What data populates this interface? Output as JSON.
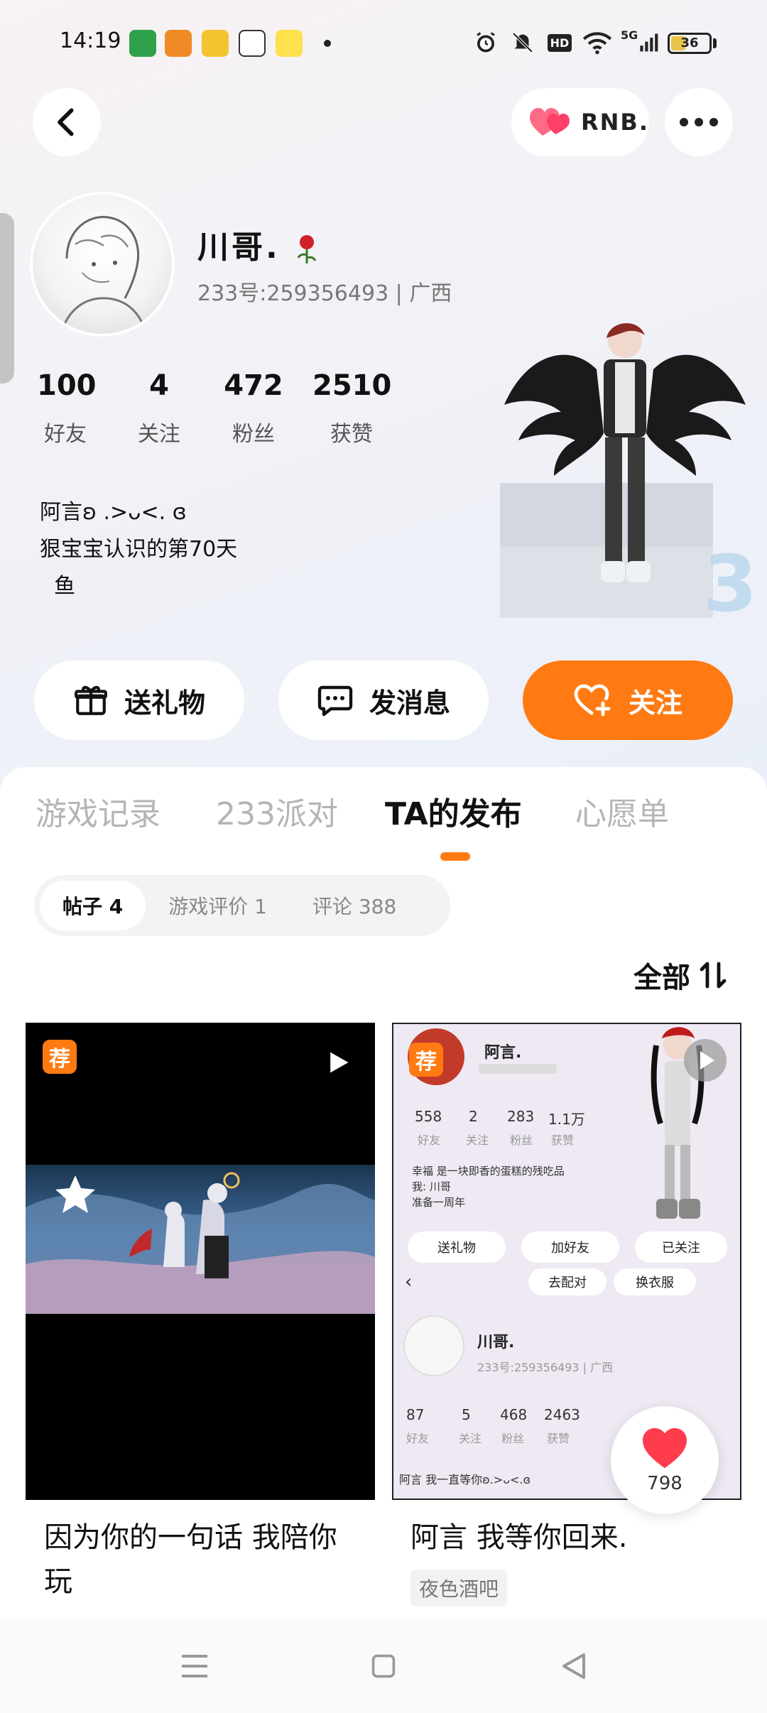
{
  "status_bar": {
    "time": "14:19",
    "battery": "36",
    "network": "5G"
  },
  "nav": {
    "rnb_label": "RNB."
  },
  "profile": {
    "name": "川哥.",
    "id_location": "233号:259356493 | 广西",
    "stats": [
      {
        "num": "100",
        "label": "好友"
      },
      {
        "num": "4",
        "label": "关注"
      },
      {
        "num": "472",
        "label": "粉丝"
      },
      {
        "num": "2510",
        "label": "获赞"
      }
    ],
    "bio": [
      "阿言ʚ .>ᴗ<. ɞ",
      "狠宝宝认识的第70天",
      "鱼"
    ]
  },
  "actions": {
    "gift": "送礼物",
    "message": "发消息",
    "follow": "关注"
  },
  "tabs": [
    "游戏记录",
    "233派对",
    "TA的发布",
    "心愿单"
  ],
  "subtabs": [
    "帖子 4",
    "游戏评价 1",
    "评论 388"
  ],
  "sort_label": "全部",
  "cards": [
    {
      "badge": "荐",
      "title": "因为你的一句话 我陪你玩"
    },
    {
      "badge": "荐",
      "title": "阿言 我等你回来.",
      "tag": "夜色酒吧"
    }
  ],
  "inner_top": {
    "name": "阿言.",
    "stats": [
      {
        "num": "558",
        "label": "好友"
      },
      {
        "num": "2",
        "label": "关注"
      },
      {
        "num": "283",
        "label": "粉丝"
      },
      {
        "num": "1.1万",
        "label": "获赞"
      }
    ],
    "bio": [
      "幸福 是一块即香的蛋糕的残吃品",
      "我: 川哥",
      "准备一周年"
    ],
    "buttons": [
      "送礼物",
      "加好友",
      "已关注"
    ],
    "bar_buttons": [
      "去配对",
      "换衣服"
    ]
  },
  "inner_bottom": {
    "name": "川哥.",
    "id": "233号:259356493 | 广西",
    "stats": [
      {
        "num": "87",
        "label": "好友"
      },
      {
        "num": "5",
        "label": "关注"
      },
      {
        "num": "468",
        "label": "粉丝"
      },
      {
        "num": "2463",
        "label": "获赞"
      }
    ],
    "bio": "阿言 我一直等你ʚ.>ᴗ<.ɞ"
  },
  "like_count": "798",
  "colors": {
    "accent": "#ff7a12",
    "badge": "#ff7a12",
    "like": "#ff3b4e"
  }
}
